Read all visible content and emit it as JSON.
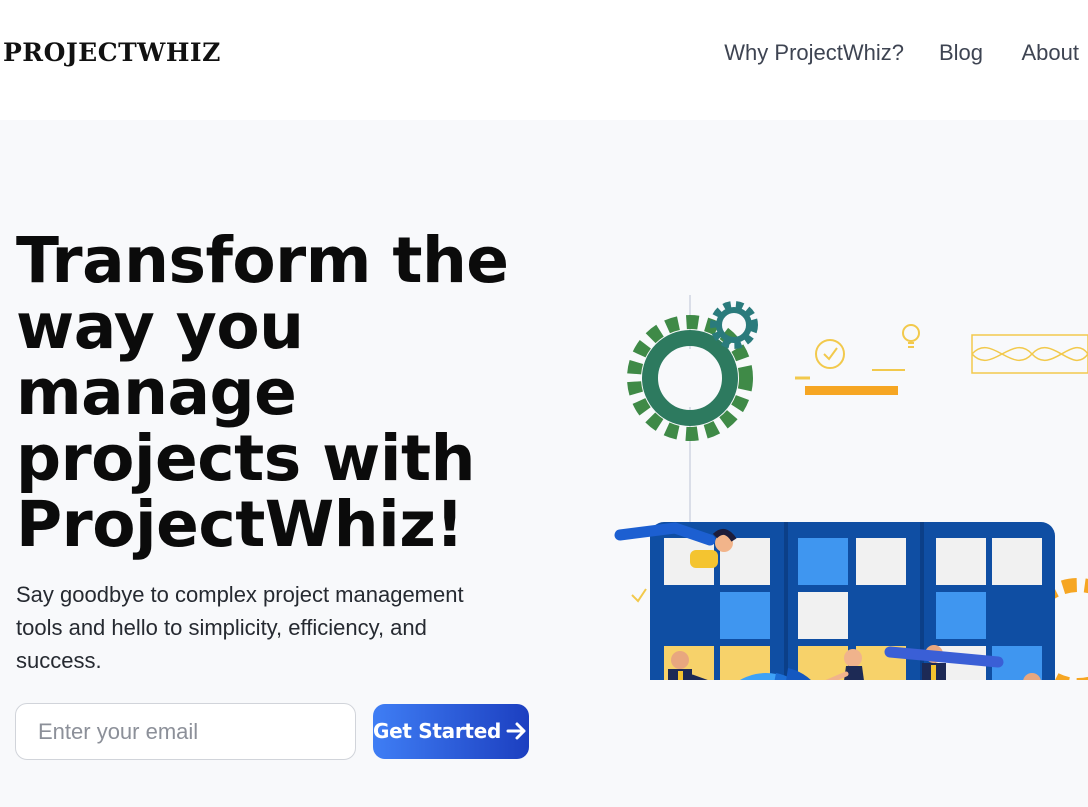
{
  "header": {
    "logo": "PROJECTWHIZ",
    "nav": [
      {
        "label": "Why ProjectWhiz?"
      },
      {
        "label": "Blog"
      },
      {
        "label": "About"
      }
    ]
  },
  "hero": {
    "headline": "Transform the way you manage projects with ProjectWhiz!",
    "subtitle": "Say goodbye to complex project management tools and hello to simplicity, efficiency, and success.",
    "email_placeholder": "Enter your email",
    "cta_label": "Get Started",
    "cta_icon": "arrow-right-icon",
    "illustration": "team-task-board-illustration"
  },
  "colors": {
    "hero_background": "#f8f9fb",
    "board_blue": "#0f4ea3",
    "cta_gradient_start": "#3f7ef5",
    "cta_gradient_end": "#1c3fc0",
    "accent_yellow": "#f4c430",
    "gear_green": "#3f8a47"
  }
}
